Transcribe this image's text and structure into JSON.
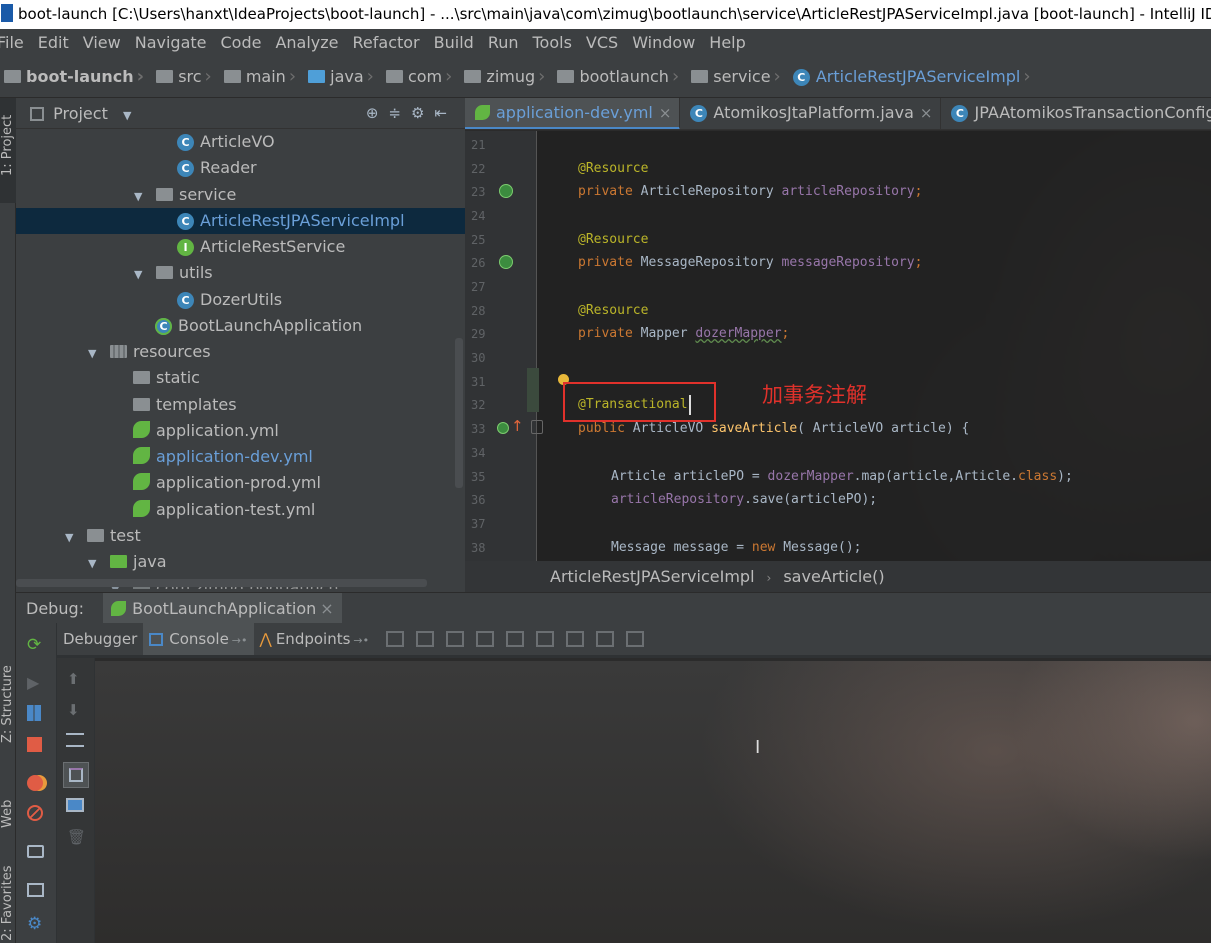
{
  "window": {
    "title": "boot-launch [C:\\Users\\hanxt\\IdeaProjects\\boot-launch] - ...\\src\\main\\java\\com\\zimug\\bootlaunch\\service\\ArticleRestJPAServiceImpl.java [boot-launch] - IntelliJ IDEA"
  },
  "menu": [
    "File",
    "Edit",
    "View",
    "Navigate",
    "Code",
    "Analyze",
    "Refactor",
    "Build",
    "Run",
    "Tools",
    "VCS",
    "Window",
    "Help"
  ],
  "navbar": {
    "crumbs": [
      "boot-launch",
      "src",
      "main",
      "java",
      "com",
      "zimug",
      "bootlaunch",
      "service",
      "ArticleRestJPAServiceImpl"
    ]
  },
  "left_stripe": {
    "project": "1: Project",
    "structure": "Z: Structure",
    "web": "Web",
    "favorites": "2: Favorites"
  },
  "project": {
    "title": "Project",
    "tree": [
      {
        "label": "ArticleVO",
        "kind": "class"
      },
      {
        "label": "Reader",
        "kind": "class"
      },
      {
        "label": "service",
        "kind": "folder"
      },
      {
        "label": "ArticleRestJPAServiceImpl",
        "kind": "class"
      },
      {
        "label": "ArticleRestService",
        "kind": "interface"
      },
      {
        "label": "utils",
        "kind": "folder"
      },
      {
        "label": "DozerUtils",
        "kind": "class"
      },
      {
        "label": "BootLaunchApplication",
        "kind": "boot"
      },
      {
        "label": "resources",
        "kind": "folder"
      },
      {
        "label": "static",
        "kind": "folder"
      },
      {
        "label": "templates",
        "kind": "folder"
      },
      {
        "label": "application.yml",
        "kind": "yml"
      },
      {
        "label": "application-dev.yml",
        "kind": "yml"
      },
      {
        "label": "application-prod.yml",
        "kind": "yml"
      },
      {
        "label": "application-test.yml",
        "kind": "yml"
      },
      {
        "label": "test",
        "kind": "folder"
      },
      {
        "label": "java",
        "kind": "folder"
      },
      {
        "label": "com.zimug.bootlaunch",
        "kind": "folder"
      }
    ]
  },
  "editor_tabs": [
    {
      "label": "application-dev.yml",
      "active": true
    },
    {
      "label": "AtomikosJtaPlatform.java",
      "active": false
    },
    {
      "label": "JPAAtomikosTransactionConfig.java",
      "active": false
    }
  ],
  "editor": {
    "line_numbers": [
      "21",
      "22",
      "23",
      "24",
      "25",
      "26",
      "27",
      "28",
      "29",
      "30",
      "31",
      "32",
      "33",
      "34",
      "35",
      "36",
      "37",
      "38"
    ],
    "annotation_label": "加事务注解",
    "code": {
      "l22": "@Resource",
      "l23_kw": "private",
      "l23_type": " ArticleRepository ",
      "l23_field": "articleRepository",
      "l23_end": ";",
      "l25": "@Resource",
      "l26_kw": "private",
      "l26_type": " MessageRepository ",
      "l26_field": "messageRepository",
      "l26_end": ";",
      "l28": "@Resource",
      "l29_kw": "private",
      "l29_type": " Mapper ",
      "l29_field": "dozerMapper",
      "l29_end": ";",
      "l32": "@Transactional",
      "l33_kw": "public",
      "l33_type": " ArticleVO ",
      "l33_fn": "saveArticle",
      "l33_rest": "( ArticleVO article) {",
      "l35_a": "Article articlePO = ",
      "l35_field": "dozerMapper",
      "l35_b": ".map(article,Article.",
      "l35_kw": "class",
      "l35_c": ");",
      "l36_field": "articleRepository",
      "l36_rest": ".save(articlePO);",
      "l38_a": "Message message = ",
      "l38_kw": "new",
      "l38_b": " Message();"
    },
    "breadcrumb": [
      "ArticleRestJPAServiceImpl",
      "saveArticle()"
    ]
  },
  "debug": {
    "label": "Debug:",
    "run_tab": "BootLaunchApplication",
    "tabs": [
      "Debugger",
      "Console",
      "Endpoints"
    ]
  }
}
